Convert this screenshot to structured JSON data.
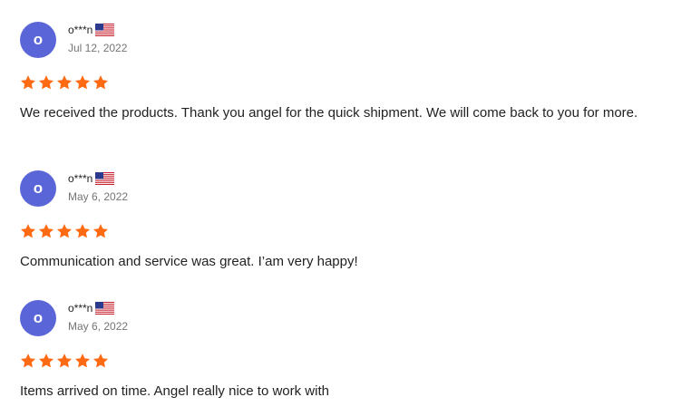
{
  "colors": {
    "avatar_bg": "#5a65d8",
    "star": "#ff6a13",
    "text": "#222222",
    "date": "#757575"
  },
  "reviews": [
    {
      "avatar_letter": "o",
      "user": "o***n",
      "flag_icon": "us-flag-icon",
      "date": "Jul 12, 2022",
      "rating": 5,
      "text": "We received the products. Thank you angel for the quick shipment. We will come back to you for more."
    },
    {
      "avatar_letter": "o",
      "user": "o***n",
      "flag_icon": "us-flag-icon",
      "date": "May 6, 2022",
      "rating": 5,
      "text": "Communication and service was great. I’am very happy!"
    },
    {
      "avatar_letter": "o",
      "user": "o***n",
      "flag_icon": "us-flag-icon",
      "date": "May 6, 2022",
      "rating": 5,
      "text": "Items arrived on time. Angel really nice to work with"
    }
  ]
}
